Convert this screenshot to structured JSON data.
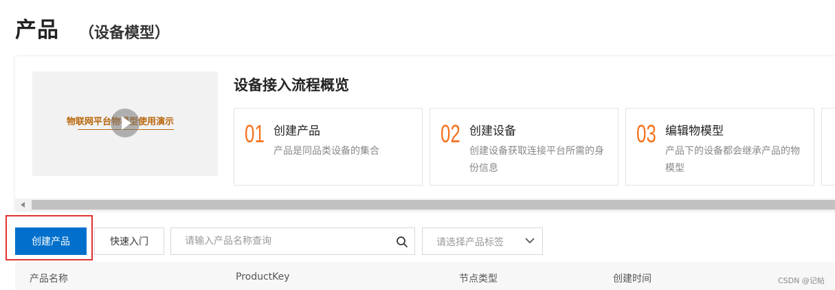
{
  "header": {
    "title": "产品",
    "subtitle": "（设备模型）"
  },
  "overview": {
    "video_caption": "物联网平台物模型使用演示",
    "flow_title": "设备接入流程概览",
    "steps": [
      {
        "num": "01",
        "title": "创建产品",
        "desc": "产品是同品类设备的集合"
      },
      {
        "num": "02",
        "title": "创建设备",
        "desc": "创建设备获取连接平台所需的身份信息"
      },
      {
        "num": "03",
        "title": "编辑物模型",
        "desc": "产品下的设备都会继承产品的物模型"
      }
    ]
  },
  "toolbar": {
    "create_label": "创建产品",
    "quickstart_label": "快速入门",
    "search_placeholder": "请输入产品名称查询",
    "tag_select_placeholder": "请选择产品标签"
  },
  "table": {
    "columns": [
      "产品名称",
      "ProductKey",
      "节点类型",
      "创建时间"
    ]
  },
  "watermark": "CSDN @记帖",
  "colors": {
    "primary": "#0070cc",
    "step_number": "#f5731e",
    "highlight": "#e03131"
  },
  "icons": {
    "search": "search-icon",
    "dropdown": "chevron-down-icon",
    "play": "play-icon"
  }
}
